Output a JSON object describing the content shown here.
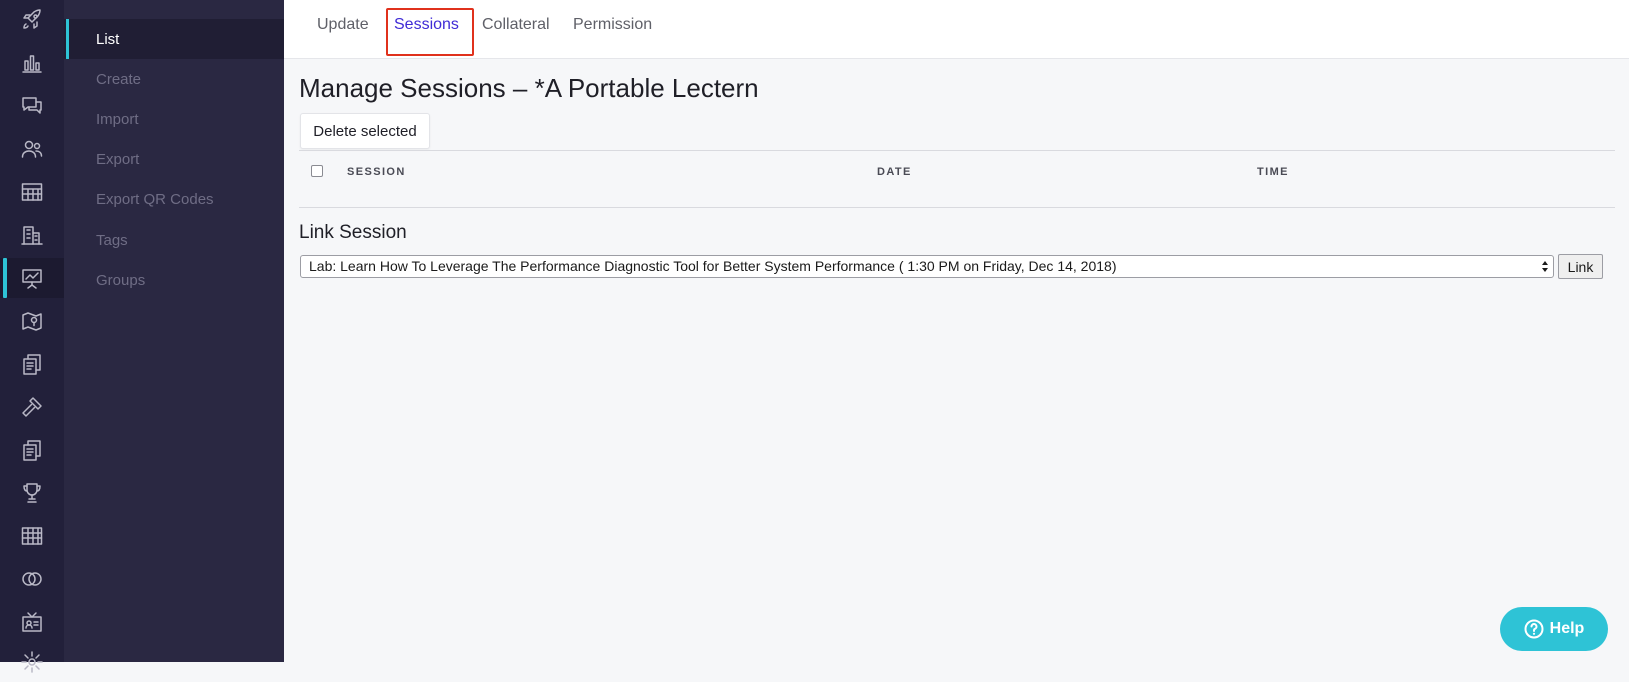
{
  "rail": {
    "items": [
      {
        "icon": "rocket-icon"
      },
      {
        "icon": "bar-chart-icon"
      },
      {
        "icon": "chat-icon"
      },
      {
        "icon": "users-icon"
      },
      {
        "icon": "table-icon"
      },
      {
        "icon": "building-icon"
      },
      {
        "icon": "presentation-icon",
        "active": true
      },
      {
        "icon": "map-pin-icon"
      },
      {
        "icon": "documents-icon"
      },
      {
        "icon": "hammer-icon"
      },
      {
        "icon": "documents-alt-icon"
      },
      {
        "icon": "trophy-icon"
      },
      {
        "icon": "grid-icon"
      },
      {
        "icon": "rings-icon"
      },
      {
        "icon": "badge-icon"
      },
      {
        "icon": "settings-icon"
      }
    ],
    "accent_color": "#2ec3d6"
  },
  "subnav": {
    "items": [
      {
        "label": "List",
        "active": true
      },
      {
        "label": "Create"
      },
      {
        "label": "Import"
      },
      {
        "label": "Export"
      },
      {
        "label": "Export QR Codes"
      },
      {
        "label": "Tags"
      },
      {
        "label": "Groups"
      }
    ]
  },
  "tabs": [
    {
      "label": "Update"
    },
    {
      "label": "Sessions",
      "active": true
    },
    {
      "label": "Collateral"
    },
    {
      "label": "Permission"
    }
  ],
  "main": {
    "title": "Manage Sessions – *A Portable Lectern",
    "delete_label": "Delete selected",
    "columns": [
      "SESSION",
      "DATE",
      "TIME"
    ],
    "link_section_title": "Link Session",
    "selected_session": "Lab: Learn How To Leverage The Performance Diagnostic Tool for Better System Performance ( 1:30 PM on Friday, Dec 14, 2018)",
    "link_label": "Link"
  },
  "help": {
    "label": "Help"
  },
  "colors": {
    "active_tab": "#3f2bd6",
    "highlight": "#e0311c",
    "help": "#2ec3d6"
  }
}
